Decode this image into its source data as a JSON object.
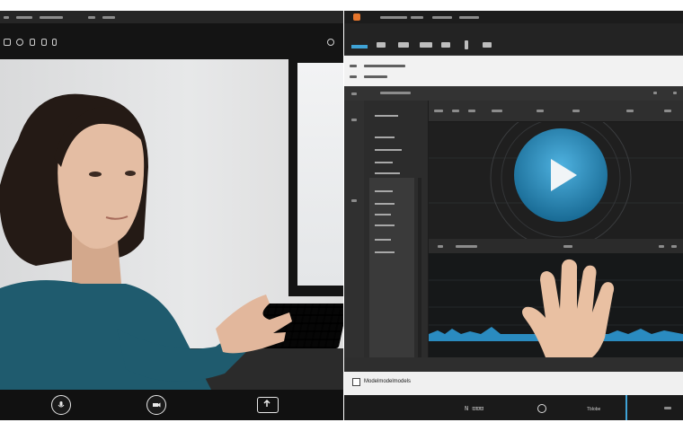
{
  "call_window": {
    "controls": [
      {
        "name": "mute-button",
        "icon": "microphone-icon"
      },
      {
        "name": "camera-button",
        "icon": "camera-icon"
      },
      {
        "name": "share-screen-button",
        "icon": "share-screen-icon"
      }
    ]
  },
  "editor": {
    "status_label": "Modelmodelmodels",
    "timecode": "N ⊡⊡⊡",
    "play_label": "Tblobe",
    "accent_color": "#3fa3d6",
    "wave_color": "#2a8bc0"
  }
}
